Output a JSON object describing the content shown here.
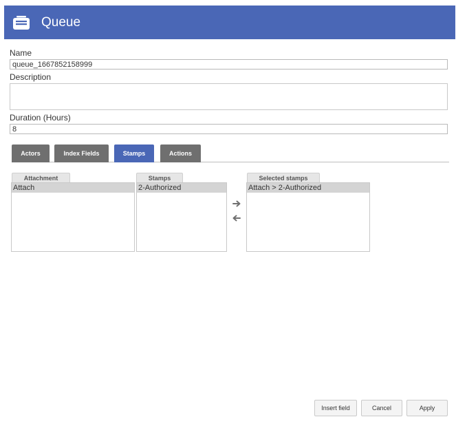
{
  "header": {
    "title": "Queue",
    "icon": "inbox-tray-icon",
    "color": "#4a67b6"
  },
  "form": {
    "name_label": "Name",
    "name_value": "queue_1667852158999",
    "description_label": "Description",
    "description_value": "",
    "duration_label": "Duration (Hours)",
    "duration_value": "8"
  },
  "tabs": [
    {
      "label": "Actors",
      "active": false
    },
    {
      "label": "Index Fields",
      "active": false
    },
    {
      "label": "Stamps",
      "active": true
    },
    {
      "label": "Actions",
      "active": false
    }
  ],
  "stamps_panel": {
    "attachment": {
      "header": "Attachment",
      "items": [
        "Attach"
      ]
    },
    "stamps": {
      "header": "Stamps",
      "items": [
        "2-Authorized"
      ]
    },
    "selected": {
      "header": "Selected stamps",
      "items": [
        "Attach > 2-Authorized"
      ]
    },
    "add_icon": "arrow-right-icon",
    "remove_icon": "arrow-left-icon"
  },
  "footer": {
    "insert_field_label": "Insert field",
    "cancel_label": "Cancel",
    "apply_label": "Apply"
  }
}
